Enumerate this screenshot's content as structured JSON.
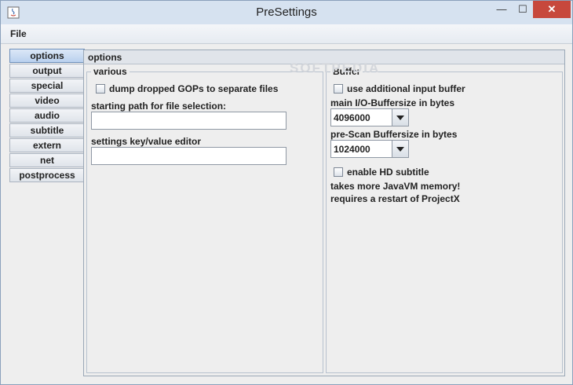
{
  "window": {
    "title": "PreSettings",
    "controls": {
      "minimize": "—",
      "maximize": "☐",
      "close": "✕"
    }
  },
  "menubar": {
    "file": "File"
  },
  "tabs": [
    "options",
    "output",
    "special",
    "video",
    "audio",
    "subtitle",
    "extern",
    "net",
    "postprocess"
  ],
  "selected_tab": "options",
  "content": {
    "title": "options",
    "watermark": "SOFTPEDIA",
    "various": {
      "legend": "various",
      "dump_gops": {
        "label": "dump dropped GOPs to separate files",
        "checked": false
      },
      "starting_path": {
        "label": "starting path for file selection:",
        "value": ""
      },
      "settings_editor": {
        "label": "settings key/value editor",
        "value": ""
      }
    },
    "buffer": {
      "legend": "Buffer",
      "use_input_buffer": {
        "label": "use additional input buffer",
        "checked": false
      },
      "main_io": {
        "label": "main I/O-Buffersize in bytes",
        "value": "4096000"
      },
      "prescan": {
        "label": "pre-Scan Buffersize in bytes",
        "value": "1024000"
      },
      "hd_subtitle": {
        "label": "enable HD subtitle",
        "checked": false
      },
      "note1": "takes more JavaVM memory!",
      "note2": "requires a restart of ProjectX"
    }
  },
  "colors": {
    "titlebar": "#d6e2f0",
    "close_button": "#c7483c",
    "selected_tab": "#b9d0ee"
  }
}
